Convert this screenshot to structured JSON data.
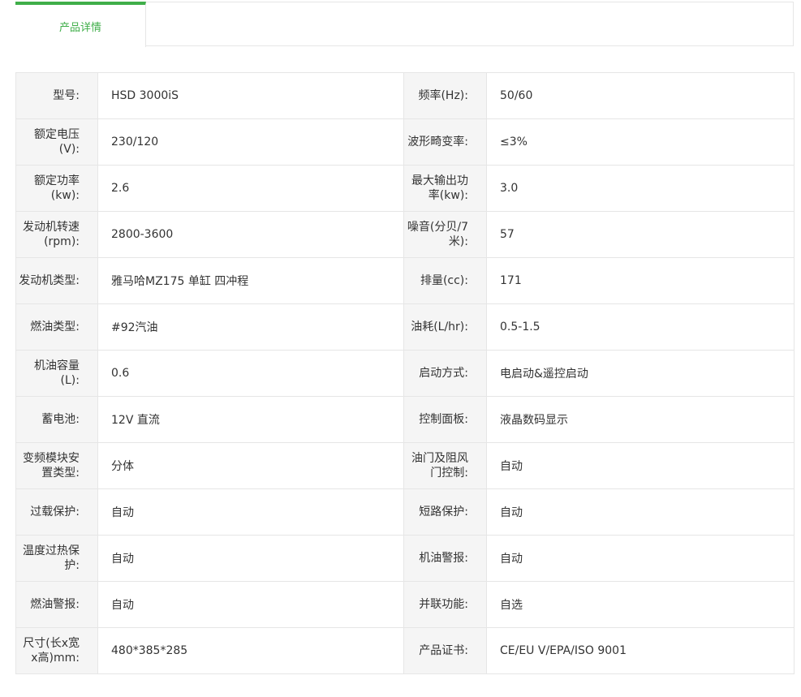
{
  "tabs": [
    {
      "label": "产品详情",
      "active": true
    }
  ],
  "colors": {
    "accent": "#3fae49",
    "label_bg": "#f5f5f5",
    "border": "#e6e6e6"
  },
  "specs": [
    {
      "l1": "型号:",
      "v1": "HSD 3000iS",
      "l2": "频率(Hz):",
      "v2": "50/60"
    },
    {
      "l1": "额定电压(V):",
      "v1": "230/120",
      "l2": "波形畸变率:",
      "v2": "≤3%"
    },
    {
      "l1": "额定功率(kw):",
      "v1": "2.6",
      "l2": "最大输出功率(kw):",
      "v2": "3.0"
    },
    {
      "l1": "发动机转速(rpm):",
      "v1": "2800-3600",
      "l2": "噪音(分贝/7米):",
      "v2": "57"
    },
    {
      "l1": "发动机类型:",
      "v1": "雅马哈MZ175 单缸 四冲程",
      "l2": "排量(cc):",
      "v2": "171"
    },
    {
      "l1": "燃油类型:",
      "v1": "#92汽油",
      "l2": "油耗(L/hr):",
      "v2": "0.5-1.5"
    },
    {
      "l1": "机油容量(L):",
      "v1": "0.6",
      "l2": "启动方式:",
      "v2": "电启动&遥控启动"
    },
    {
      "l1": "蓄电池:",
      "v1": "12V 直流",
      "l2": "控制面板:",
      "v2": "液晶数码显示"
    },
    {
      "l1": "变频模块安置类型:",
      "v1": "分体",
      "l2": "油门及阻风门控制:",
      "v2": "自动"
    },
    {
      "l1": "过载保护:",
      "v1": "自动",
      "l2": "短路保护:",
      "v2": "自动"
    },
    {
      "l1": "温度过热保护:",
      "v1": "自动",
      "l2": "机油警报:",
      "v2": "自动"
    },
    {
      "l1": "燃油警报:",
      "v1": "自动",
      "l2": "并联功能:",
      "v2": "自选"
    },
    {
      "l1": "尺寸(长x宽x高)mm:",
      "v1": "480*385*285",
      "l2": "产品证书:",
      "v2": "CE/EU V/EPA/ISO 9001"
    }
  ]
}
